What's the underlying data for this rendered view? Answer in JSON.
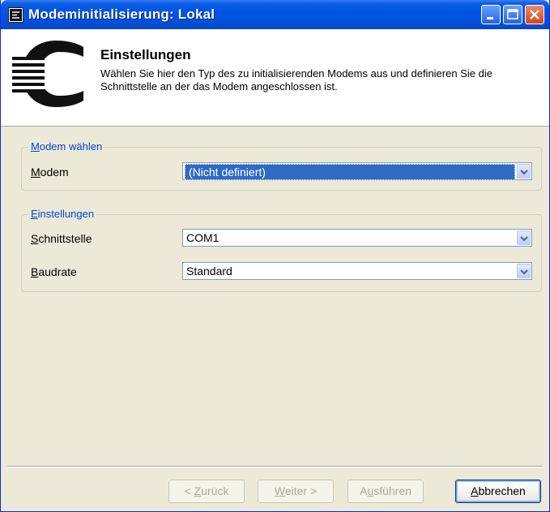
{
  "window": {
    "title": "Modeminitialisierung: Lokal"
  },
  "header": {
    "title": "Einstellungen",
    "description": "Wählen Sie hier den Typ des zu initialisierenden Modems aus und definieren Sie die Schnittstelle an der das Modem angeschlossen ist."
  },
  "group_modem": {
    "legend_prefix": "M",
    "legend_rest": "odem wählen",
    "modem_label_prefix": "M",
    "modem_label_rest": "odem",
    "modem_value": "(Nicht definiert)"
  },
  "group_settings": {
    "legend_prefix": "E",
    "legend_rest": "instellungen",
    "port_label_prefix": "S",
    "port_label_rest": "chnittstelle",
    "port_value": "COM1",
    "baud_label_prefix": "B",
    "baud_label_rest": "audrate",
    "baud_value": "Standard"
  },
  "buttons": {
    "back_pre": "< ",
    "back_key": "Z",
    "back_rest": "urück",
    "next_key": "W",
    "next_rest": "eiter >",
    "run_pre": "A",
    "run_key": "u",
    "run_rest": "sführen",
    "cancel_key": "A",
    "cancel_rest": "bbrechen"
  },
  "colors": {
    "titlebar": "#0054e3",
    "legend": "#0046d5",
    "selection": "#316ac5",
    "face": "#ece9d8"
  }
}
